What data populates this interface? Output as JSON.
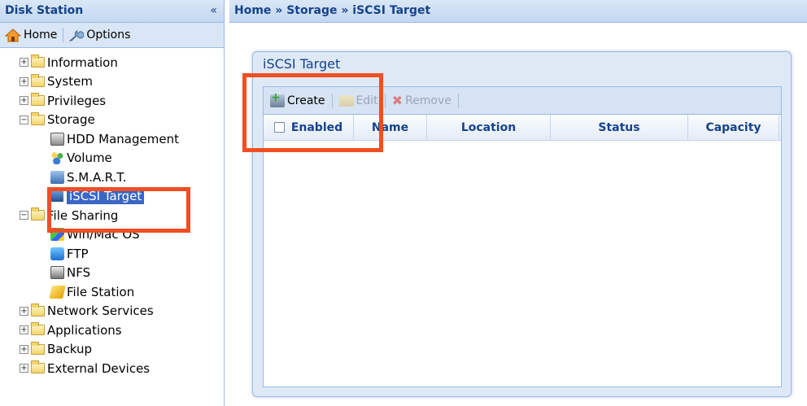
{
  "sidebar": {
    "title": "Disk Station",
    "collapse_glyph": "«",
    "toolbar": {
      "home_label": "Home",
      "options_label": "Options"
    },
    "tree": [
      {
        "label": "Information",
        "level": 0,
        "expanded": false
      },
      {
        "label": "System",
        "level": 0,
        "expanded": false
      },
      {
        "label": "Privileges",
        "level": 0,
        "expanded": false
      },
      {
        "label": "Storage",
        "level": 0,
        "expanded": true
      },
      {
        "label": "HDD Management",
        "level": 1,
        "icon": "hdd-icon"
      },
      {
        "label": "Volume",
        "level": 1,
        "icon": "volume-icon"
      },
      {
        "label": "S.M.A.R.T.",
        "level": 1,
        "icon": "smart-icon"
      },
      {
        "label": "iSCSI Target",
        "level": 1,
        "icon": "iscsi-icon",
        "selected": true
      },
      {
        "label": "File Sharing",
        "level": 0,
        "expanded": true
      },
      {
        "label": "Win/Mac OS",
        "level": 1,
        "icon": "winmac-icon"
      },
      {
        "label": "FTP",
        "level": 1,
        "icon": "ftp-icon"
      },
      {
        "label": "NFS",
        "level": 1,
        "icon": "nfs-icon"
      },
      {
        "label": "File Station",
        "level": 1,
        "icon": "file-station-icon"
      },
      {
        "label": "Network Services",
        "level": 0,
        "expanded": false
      },
      {
        "label": "Applications",
        "level": 0,
        "expanded": false
      },
      {
        "label": "Backup",
        "level": 0,
        "expanded": false
      },
      {
        "label": "External Devices",
        "level": 0,
        "expanded": false
      }
    ]
  },
  "breadcrumb": "Home » Storage » iSCSI Target",
  "panel": {
    "title": "iSCSI Target",
    "toolbar": {
      "create": "Create",
      "edit": "Edit",
      "remove": "Remove"
    },
    "columns": [
      "Enabled",
      "Name",
      "Location",
      "Status",
      "Capacity"
    ]
  },
  "colors": {
    "highlight": "#f04e23",
    "header_text": "#15428b",
    "selection": "#3a66c4"
  }
}
